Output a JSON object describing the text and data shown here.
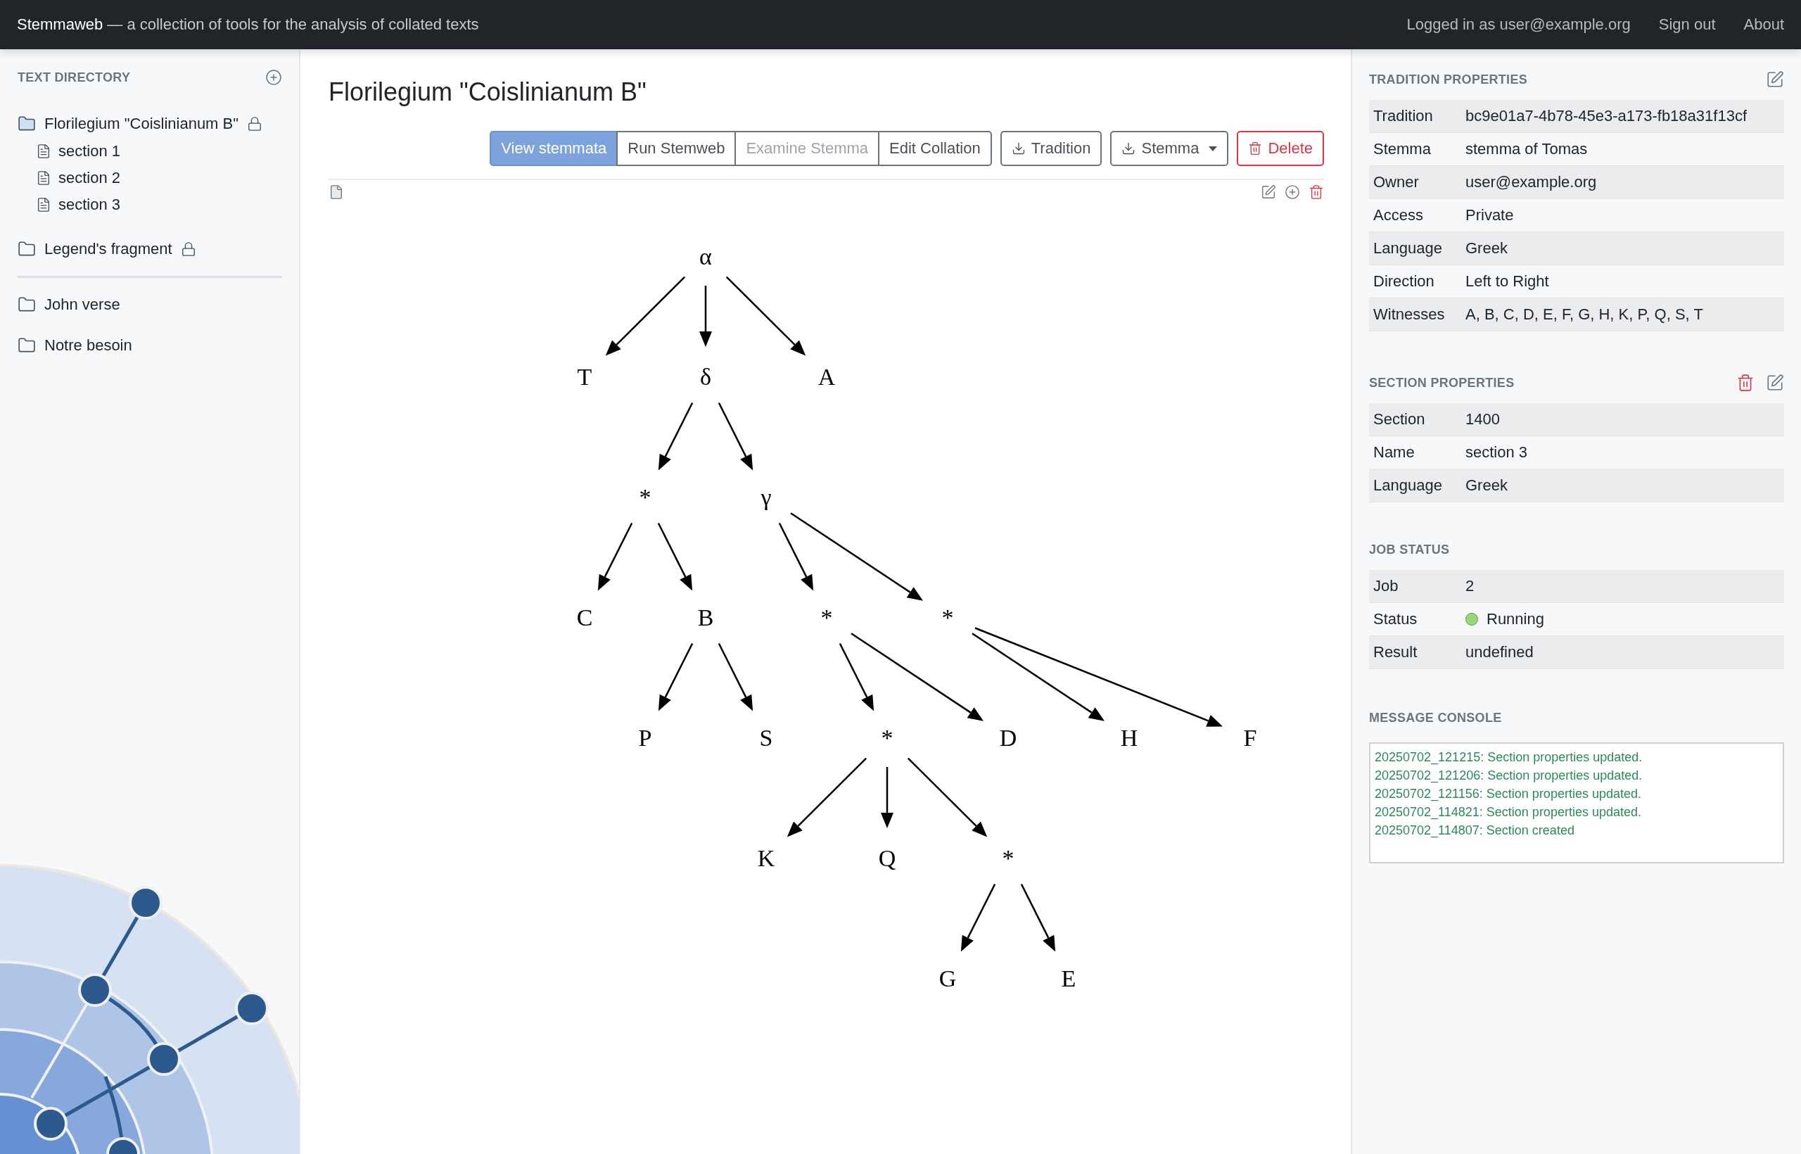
{
  "header": {
    "brand": "Stemmaweb",
    "tagline": "— a collection of tools for the analysis of collated texts",
    "user": "Logged in as user@example.org",
    "links": [
      "Sign out",
      "About"
    ]
  },
  "sidebar": {
    "heading": "TEXT DIRECTORY",
    "traditions": [
      {
        "name": "Florilegium \"Coislinianum B\"",
        "locked": true,
        "selected": true,
        "sections": [
          "section 1",
          "section 2",
          "section 3"
        ]
      },
      {
        "name": "Legend's fragment",
        "locked": true,
        "selected": false
      }
    ],
    "other_traditions": [
      {
        "name": "John verse",
        "locked": false,
        "selected": false
      },
      {
        "name": "Notre besoin",
        "locked": false,
        "selected": false
      }
    ]
  },
  "main": {
    "title": "Florilegium \"Coislinianum B\"",
    "toolbar": [
      {
        "label": "View stemmata",
        "kind": "tab",
        "selected": true,
        "disabled": false
      },
      {
        "label": "Run Stemweb",
        "kind": "tab",
        "selected": false,
        "disabled": false
      },
      {
        "label": "Examine Stemma",
        "kind": "tab",
        "selected": false,
        "disabled": true
      },
      {
        "label": "Edit Collation",
        "kind": "tab",
        "selected": false,
        "disabled": false
      },
      {
        "label": "Tradition",
        "kind": "download"
      },
      {
        "label": "Stemma",
        "kind": "dropdown"
      },
      {
        "label": "Delete",
        "kind": "danger"
      }
    ],
    "stemma": {
      "label": "α",
      "children": [
        {
          "label": "T"
        },
        {
          "label": "δ",
          "children": [
            {
              "label": "*",
              "children": [
                {
                  "label": "C"
                },
                {
                  "label": "B",
                  "children": [
                    {
                      "label": "P"
                    },
                    {
                      "label": "S"
                    }
                  ]
                }
              ]
            },
            {
              "label": "γ",
              "children": [
                {
                  "label": "*",
                  "children": [
                    {
                      "label": "*",
                      "children": [
                        {
                          "label": "K"
                        },
                        {
                          "label": "Q"
                        },
                        {
                          "label": "*",
                          "children": [
                            {
                              "label": "G"
                            },
                            {
                              "label": "E"
                            }
                          ]
                        }
                      ]
                    },
                    {
                      "label": "D"
                    }
                  ]
                },
                {
                  "label": "*",
                  "children": [
                    {
                      "label": "H"
                    },
                    {
                      "label": "F"
                    }
                  ]
                }
              ]
            }
          ]
        },
        {
          "label": "A"
        }
      ]
    }
  },
  "tradition_properties": {
    "heading": "TRADITION PROPERTIES",
    "rows": [
      {
        "label": "Tradition",
        "value": "bc9e01a7-4b78-45e3-a173-fb18a31f13cf"
      },
      {
        "label": "Stemma",
        "value": "stemma of Tomas"
      },
      {
        "label": "Owner",
        "value": "user@example.org"
      },
      {
        "label": "Access",
        "value": "Private"
      },
      {
        "label": "Language",
        "value": "Greek"
      },
      {
        "label": "Direction",
        "value": "Left to Right"
      },
      {
        "label": "Witnesses",
        "value": "A, B, C, D, E, F, G, H, K, P, Q, S, T"
      }
    ]
  },
  "section_properties": {
    "heading": "SECTION PROPERTIES",
    "rows": [
      {
        "label": "Section",
        "value": "1400"
      },
      {
        "label": "Name",
        "value": "section 3"
      },
      {
        "label": "Language",
        "value": "Greek"
      }
    ]
  },
  "job_status": {
    "heading": "JOB STATUS",
    "rows": [
      {
        "label": "Job",
        "value": "2"
      },
      {
        "label": "Status",
        "value": "Running",
        "color": "#9bd67a"
      },
      {
        "label": "Result",
        "value": "undefined"
      }
    ]
  },
  "message_console": {
    "heading": "MESSAGE CONSOLE",
    "messages": [
      "20250702_121215: Section properties updated.",
      "20250702_121206: Section properties updated.",
      "20250702_121156: Section properties updated.",
      "20250702_114821: Section properties updated.",
      "20250702_114807: Section created"
    ]
  }
}
